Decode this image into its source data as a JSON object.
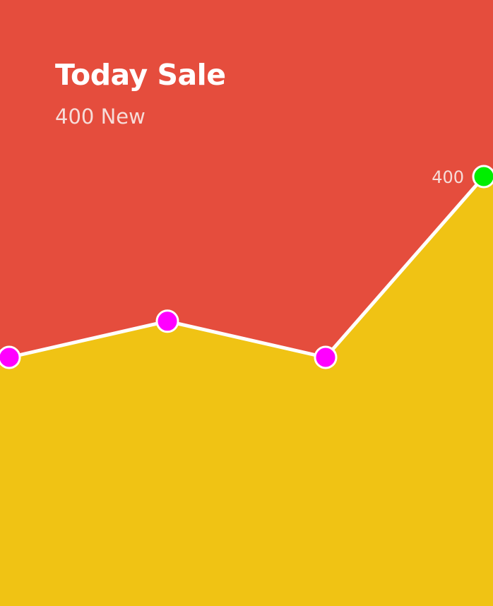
{
  "card": {
    "title": "Today Sale",
    "subtitle": "400 New"
  },
  "colors": {
    "background": "#e54d3d",
    "area_fill": "#f0c314",
    "line": "#ffffff",
    "point": "#ff00ff",
    "highlight_point": "#00ee00",
    "label": "#f6ddd9"
  },
  "chart_data": {
    "type": "area",
    "x": [
      1,
      2,
      3,
      4
    ],
    "series": [
      {
        "values": [
          300,
          320,
          300,
          400
        ]
      }
    ],
    "data_labels": [
      {
        "index": 3,
        "text": "400"
      }
    ],
    "ylim": [
      0,
      420
    ],
    "grid": false,
    "legend": "none"
  }
}
